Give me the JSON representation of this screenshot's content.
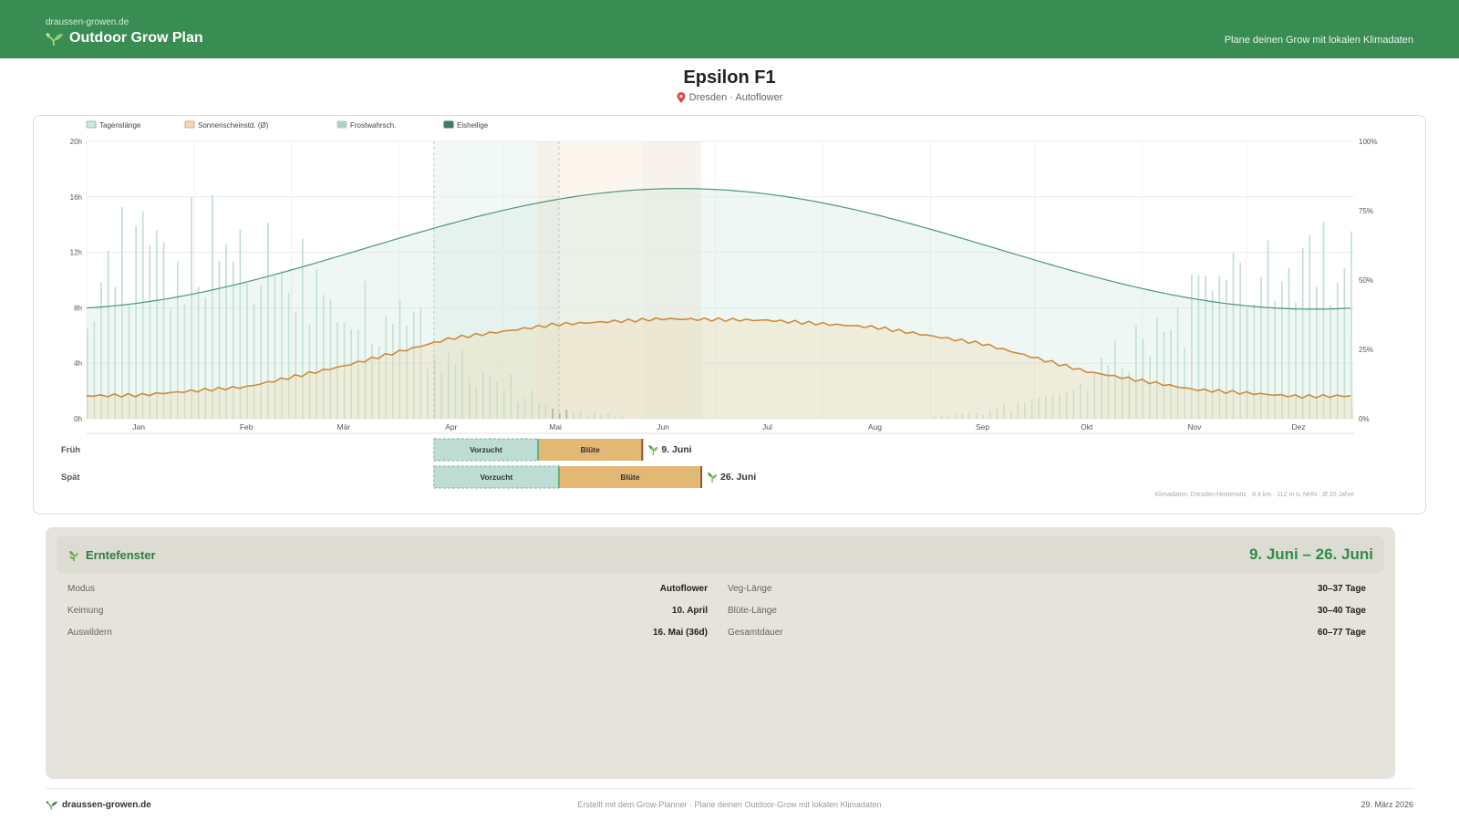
{
  "header": {
    "site": "draussen-growen.de",
    "brand": "Outdoor Grow Plan",
    "tagline": "Plane deinen Grow mit lokalen Klimadaten"
  },
  "plan": {
    "title": "Epsilon F1",
    "location": "Dresden",
    "mode": "Autoflower",
    "subtitle": "Dresden · Autoflower"
  },
  "legend": {
    "day_length": "Tagenslänge",
    "sunshine": "Sonnenscheinstd. (Ø)",
    "frost": "Frostwahrsch.",
    "ice_saints": "Eisheilige"
  },
  "colors": {
    "header_green": "#3a8d52",
    "day_length_line": "#4c9580",
    "sunshine_line": "#d08a3a",
    "frost_bar": "#a9d2c0",
    "vorzucht": "#bcdcd4",
    "bluete": "#e3b774"
  },
  "chart_data": {
    "type": "line",
    "x_labels": [
      "Jan",
      "Feb",
      "Mär",
      "Apr",
      "Mai",
      "Jun",
      "Jul",
      "Aug",
      "Sep",
      "Okt",
      "Nov",
      "Dez"
    ],
    "y_left": {
      "ticks": [
        "0h",
        "4h",
        "8h",
        "12h",
        "16h",
        "20h"
      ],
      "ylim": [
        0,
        20
      ]
    },
    "y_right": {
      "ticks": [
        "0%",
        "25%",
        "50%",
        "75%",
        "100%"
      ],
      "ylim": [
        0,
        100
      ]
    },
    "series": [
      {
        "name": "Tagenslänge",
        "min_hours": 7.9,
        "max_hours": 16.6,
        "peak_month_fraction": 5.65
      },
      {
        "name": "Sonnenscheinstd. (Ø)",
        "monthly_hours": [
          1.7,
          2.3,
          3.8,
          5.8,
          6.8,
          7.2,
          7.1,
          6.6,
          5.4,
          3.4,
          2.1,
          1.6
        ]
      },
      {
        "name": "Frostwahrsch.",
        "monthly_percent": [
          60,
          64,
          50,
          25,
          3,
          0,
          0,
          0,
          2,
          14,
          44,
          58
        ]
      }
    ],
    "ice_saints_days": [
      134,
      135,
      136,
      137,
      138
    ],
    "grid": true
  },
  "schedule": {
    "rows": [
      {
        "label": "Früh",
        "vorzucht": "Vorzucht",
        "bluete": "Blüte",
        "harvest": "9. Juni",
        "start_doy": 100,
        "transplant_doy": 130,
        "end_doy": 160
      },
      {
        "label": "Spät",
        "vorzucht": "Vorzucht",
        "bluete": "Blüte",
        "harvest": "26. Juni",
        "start_doy": 100,
        "transplant_doy": 136,
        "end_doy": 177
      }
    ]
  },
  "attribution": "Klimadaten: Dresden-Hosterwitz · 8,4 km · 112 m ü. NHN · Ø 20 Jahre",
  "harvest": {
    "label": "Erntefenster",
    "range": "9. Juni – 26. Juni",
    "left": [
      {
        "k": "Modus",
        "v": "Autoflower"
      },
      {
        "k": "Keimung",
        "v": "10. April"
      },
      {
        "k": "Auswildern",
        "v": "16. Mai (36d)"
      }
    ],
    "right": [
      {
        "k": "Veg-Länge",
        "v": "30–37 Tage"
      },
      {
        "k": "Blüte-Länge",
        "v": "30–40 Tage"
      },
      {
        "k": "Gesamtdauer",
        "v": "60–77 Tage"
      }
    ]
  },
  "footer": {
    "brand": "draussen-growen.de",
    "credit": "Erstellt mit dem Grow-Planner · Plane deinen Outdoor-Grow mit lokalen Klimadaten",
    "date": "29. März 2026"
  }
}
